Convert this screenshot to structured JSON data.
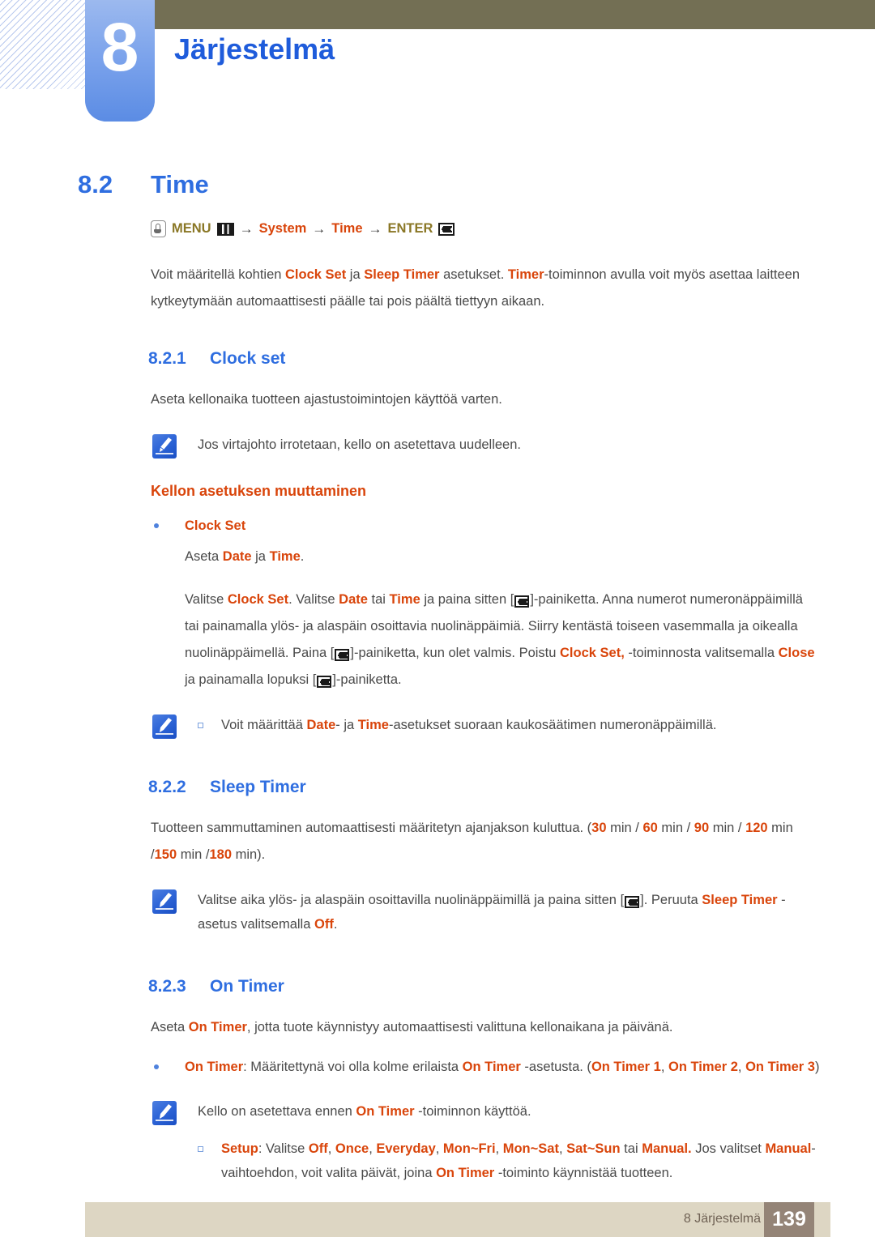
{
  "header": {
    "chapter_number": "8",
    "chapter_title": "Järjestelmä",
    "colors": {
      "tab": "#7da4ec",
      "bar": "#736f54",
      "title": "#1f5cdb"
    }
  },
  "section": {
    "number": "8.2",
    "title": "Time"
  },
  "navpath": {
    "touch_icon": "touch-hand-icon",
    "menu_label": "MENU",
    "grid_icon": "menu-grid-icon",
    "arrow1": "→",
    "system_label": "System",
    "arrow2": "→",
    "time_label": "Time",
    "arrow3": "→",
    "enter_label": "ENTER",
    "enter_icon": "enter-key-icon"
  },
  "intro": {
    "p1_a": "Voit määritellä kohtien ",
    "p1_b": "Clock Set",
    "p1_c": " ja ",
    "p1_d": "Sleep Timer",
    "p1_e": " asetukset. ",
    "p1_f": "Timer",
    "p1_g": "-toiminnon avulla voit myös asettaa laitteen kytkeytymään automaattisesti päälle tai pois päältä tiettyyn aikaan."
  },
  "clock_set": {
    "number": "8.2.1",
    "title": "Clock set",
    "desc": "Aseta kellonaika tuotteen ajastustoimintojen käyttöä varten.",
    "note": "Jos virtajohto irrotetaan, kello on asetettava uudelleen.",
    "sub_head": "Kellon asetuksen muuttaminen",
    "bullet_label": "Clock Set",
    "line1_a": "Aseta ",
    "line1_b": "Date",
    "line1_c": " ja ",
    "line1_d": "Time",
    "line1_e": ".",
    "para_a": "Valitse ",
    "para_b": "Clock Set",
    "para_c": ". Valitse ",
    "para_d": "Date",
    "para_e": " tai ",
    "para_f": "Time",
    "para_g": " ja paina sitten [",
    "para_h": "]-painiketta. Anna numerot numeronäppäimillä tai painamalla ylös- ja alaspäin osoittavia nuolinäppäimiä. Siirry kentästä toiseen vasemmalla ja oikealla nuolinäppäimellä. Paina [",
    "para_i": "]-painiketta, kun olet valmis. Poistu ",
    "para_j": "Clock Set,",
    "para_k": " -toiminnosta valitsemalla ",
    "para_l": "Close",
    "para_m": " ja painamalla lopuksi [",
    "para_n": "]-painiketta.",
    "note2_a": "Voit määrittää ",
    "note2_b": "Date",
    "note2_c": "- ja ",
    "note2_d": "Time",
    "note2_e": "-asetukset suoraan kaukosäätimen numeronäppäimillä."
  },
  "sleep_timer": {
    "number": "8.2.2",
    "title": "Sleep Timer",
    "desc_a": "Tuotteen sammuttaminen automaattisesti määritetyn ajanjakson kuluttua. (",
    "v30": "30",
    "desc_b": " min / ",
    "v60": "60",
    "desc_c": " min / ",
    "v90": "90",
    "desc_d": " min / ",
    "v120": "120",
    "desc_e": " min /",
    "v150": "150",
    "desc_f": " min /",
    "v180": "180",
    "desc_g": " min).",
    "note_a": "Valitse aika ylös- ja alaspäin osoittavilla nuolinäppäimillä ja paina sitten [",
    "note_b": "]. Peruuta ",
    "note_c": "Sleep Timer",
    "note_d": " -asetus valitsemalla ",
    "note_e": "Off",
    "note_f": "."
  },
  "on_timer": {
    "number": "8.2.3",
    "title": "On Timer",
    "desc_a": "Aseta ",
    "desc_b": "On Timer",
    "desc_c": ", jotta tuote käynnistyy automaattisesti valittuna kellonaikana ja päivänä.",
    "b1_a": "On Timer",
    "b1_b": ": Määritettynä voi olla kolme erilaista ",
    "b1_c": "On Timer",
    "b1_d": " -asetusta. (",
    "b1_e": "On Timer 1",
    "b1_f": ", ",
    "b1_g": "On Timer 2",
    "b1_h": ", ",
    "b1_i": "On Timer 3",
    "b1_j": ")",
    "note_a": "Kello on asetettava ennen ",
    "note_b": "On Timer",
    "note_c": " -toiminnon käyttöä.",
    "setup_a": "Setup",
    "setup_b": ": Valitse ",
    "opt_off": "Off",
    "sep1": ", ",
    "opt_once": "Once",
    "sep2": ", ",
    "opt_everyday": "Everyday",
    "sep3": ", ",
    "opt_monfri": "Mon~Fri",
    "sep4": ", ",
    "opt_monsat": "Mon~Sat",
    "sep5": ", ",
    "opt_satsun": "Sat~Sun",
    "sep6": " tai ",
    "opt_manual": "Manual.",
    "setup_c": " Jos valitset ",
    "setup_d": "Manual",
    "setup_e": "-vaihtoehdon, voit valita päivät, joina ",
    "setup_f": "On Timer",
    "setup_g": " -toiminto käynnistää tuotteen."
  },
  "footer": {
    "label": "8 Järjestelmä",
    "page": "139"
  }
}
